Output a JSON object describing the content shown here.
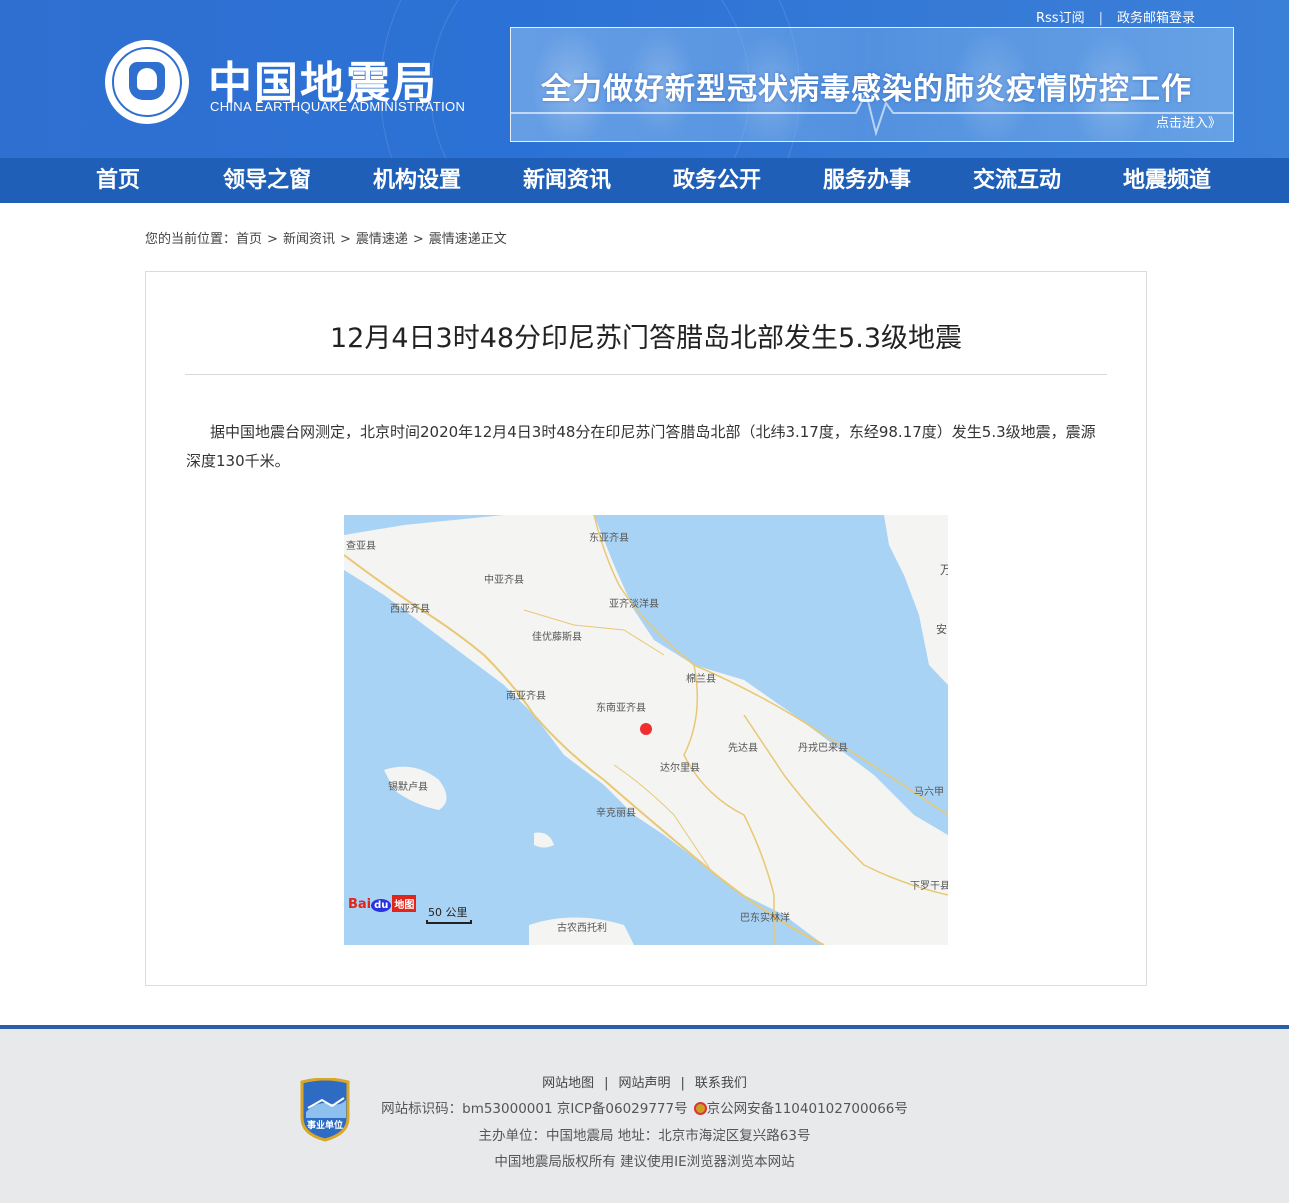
{
  "header": {
    "rss": "Rss订阅",
    "separator": "|",
    "mail_login": "政务邮箱登录",
    "org_name_cn": "中国地震局",
    "org_name_en": "CHINA EARTHQUAKE ADMINISTRATION",
    "banner_title": "全力做好新型冠状病毒感染的肺炎疫情防控工作",
    "banner_link": "点击进入》"
  },
  "nav": {
    "items": [
      "首页",
      "领导之窗",
      "机构设置",
      "新闻资讯",
      "政务公开",
      "服务办事",
      "交流互动",
      "地震频道"
    ]
  },
  "breadcrumb": {
    "prefix": "您的当前位置：",
    "items": [
      "首页",
      "新闻资讯",
      "震情速递",
      "震情速递正文"
    ],
    "sep": ">"
  },
  "article": {
    "title": "12月4日3时48分印尼苏门答腊岛北部发生5.3级地震",
    "body": "据中国地震台网测定，北京时间2020年12月4日3时48分在印尼苏门答腊岛北部（北纬3.17度，东经98.17度）发生5.3级地震，震源深度130千米。"
  },
  "map": {
    "labels": [
      "查亚县",
      "东亚齐县",
      "中亚齐县",
      "西亚齐县",
      "亚齐淡洋县",
      "佳优藤斯县",
      "棉兰县",
      "南亚齐县",
      "东南亚齐县",
      "先达县",
      "丹戎巴来县",
      "达尔里县",
      "锡默卢县",
      "辛克丽县",
      "马六甲",
      "下罗干县",
      "巴东实林洋",
      "古农西托利",
      "万",
      "安"
    ],
    "scale": "50 公里",
    "logo_bai": "Bai",
    "logo_du": "du",
    "logo_tu": "地图",
    "quake_color": "#ef2f2f"
  },
  "footer": {
    "links": [
      "网站地图",
      "网站声明",
      "联系我们"
    ],
    "bar": "|",
    "id_line": "网站标识码：bm53000001  京ICP备06029777号",
    "police_line": "京公网安备11040102700066号",
    "host_line": "主办单位：中国地震局  地址：北京市海淀区复兴路63号",
    "copyright_line": "中国地震局版权所有  建议使用IE浏览器浏览本网站",
    "badge_text": "事业单位"
  }
}
